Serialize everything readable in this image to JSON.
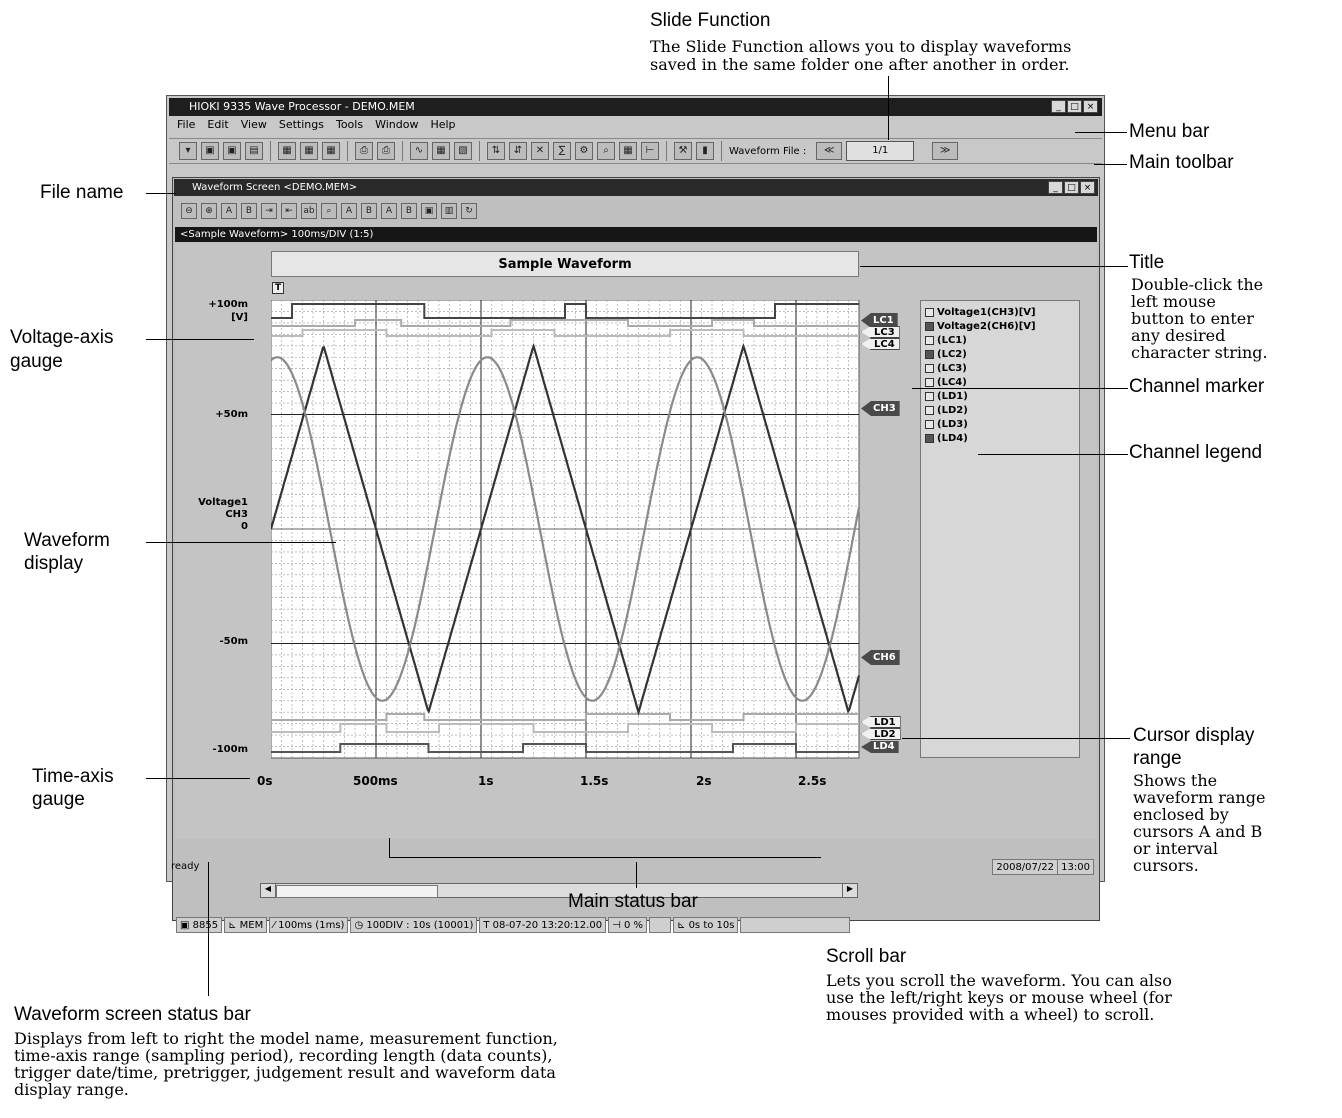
{
  "app": {
    "title": "HIOKI 9335 Wave Processor - DEMO.MEM",
    "menu": [
      "File",
      "Edit",
      "View",
      "Settings",
      "Tools",
      "Window",
      "Help"
    ],
    "waveform_file_label": "Waveform File :",
    "waveform_file_value": "1/1",
    "prev_button": "≪",
    "next_button": "≫"
  },
  "child": {
    "title": "Waveform Screen <DEMO.MEM>",
    "header": "<Sample Waveform> 100ms/DIV (1:5)",
    "chart_title": "Sample Waveform",
    "trigger_mark": "T"
  },
  "chart_data": {
    "type": "line",
    "title": "Sample Waveform",
    "x_ticks": [
      "0s",
      "500ms",
      "1s",
      "1.5s",
      "2s",
      "2.5s"
    ],
    "y_ticks": [
      "+100m",
      "[V]",
      "+50m",
      "0",
      "-50m",
      "-100m"
    ],
    "y_axis_label": [
      "Voltage1",
      "CH3"
    ],
    "xlim": [
      0,
      2.8
    ],
    "ylim": [
      -100,
      100
    ],
    "series": [
      {
        "name": "Voltage1(CH3)[V]",
        "shape": "triangle",
        "period_s": 1.0,
        "amplitude_mV": 80,
        "color": "#333333"
      },
      {
        "name": "Voltage2(CH6)[V]",
        "shape": "sine",
        "period_s": 1.0,
        "amplitude_mV": 75,
        "color": "#8a8a8a"
      }
    ],
    "grid": true
  },
  "markers": {
    "top": [
      "LC1",
      "LC3",
      "LC4"
    ],
    "ch3": "CH3",
    "ch6": "CH6",
    "bottom": [
      "LD1",
      "LD2",
      "LD4"
    ]
  },
  "legend": [
    {
      "label": "Voltage1(CH3)[V]",
      "icon": "sine-icon",
      "dark": false
    },
    {
      "label": "Voltage2(CH6)[V]",
      "icon": "sine-icon",
      "dark": true
    },
    {
      "label": "(LC1)",
      "icon": "pulse-icon",
      "dark": false
    },
    {
      "label": "(LC2)",
      "icon": "pulse-icon",
      "dark": true
    },
    {
      "label": "(LC3)",
      "icon": "pulse-icon",
      "dark": false
    },
    {
      "label": "(LC4)",
      "icon": "pulse-icon",
      "dark": false
    },
    {
      "label": "(LD1)",
      "icon": "pulse-icon",
      "dark": false
    },
    {
      "label": "(LD2)",
      "icon": "pulse-icon",
      "dark": false
    },
    {
      "label": "(LD3)",
      "icon": "pulse-icon",
      "dark": false
    },
    {
      "label": "(LD4)",
      "icon": "pulse-icon",
      "dark": true
    }
  ],
  "status": {
    "model": "8855",
    "function": "MEM",
    "time_axis": "100ms (1ms)",
    "record_length": "100DIV : 10s (10001)",
    "trigger_time": "08-07-20 13:20:12.00",
    "pretrigger": "0 %",
    "range": "0s to 10s",
    "ready": "ready",
    "date": "2008/07/22",
    "time": "13:00"
  },
  "annotations": {
    "slide_head": "Slide Function",
    "slide_text": [
      "The Slide Function allows you to display waveforms",
      "saved  in the same folder one after another in order."
    ],
    "menu_bar": "Menu bar",
    "main_toolbar": "Main toolbar",
    "file_name": "File name",
    "title_head": "Title",
    "title_text": [
      "Double-click the",
      "left mouse",
      "button to enter",
      "any desired",
      "character string."
    ],
    "voltage_gauge": [
      "Voltage-axis",
      "gauge"
    ],
    "channel_marker": "Channel marker",
    "channel_legend": "Channel legend",
    "waveform_display": [
      "Waveform",
      "display"
    ],
    "cursor_head": [
      "Cursor display",
      "range"
    ],
    "cursor_text": [
      "Shows the",
      "waveform range",
      "enclosed by",
      "cursors A and B",
      "or interval",
      "cursors."
    ],
    "time_gauge": [
      "Time-axis",
      "gauge"
    ],
    "main_status": "Main status bar",
    "scroll_head": "Scroll bar",
    "scroll_text": [
      "Lets you scroll the waveform. You can also",
      "use the left/right keys or mouse wheel (for",
      "mouses provided with a wheel) to scroll."
    ],
    "wss_head": "Waveform screen status bar",
    "wss_text": [
      "Displays from left to right the model name, measurement function,",
      "time-axis range (sampling period), recording length (data counts),",
      "trigger date/time, pretrigger, judgement result and waveform data",
      "display range."
    ]
  }
}
